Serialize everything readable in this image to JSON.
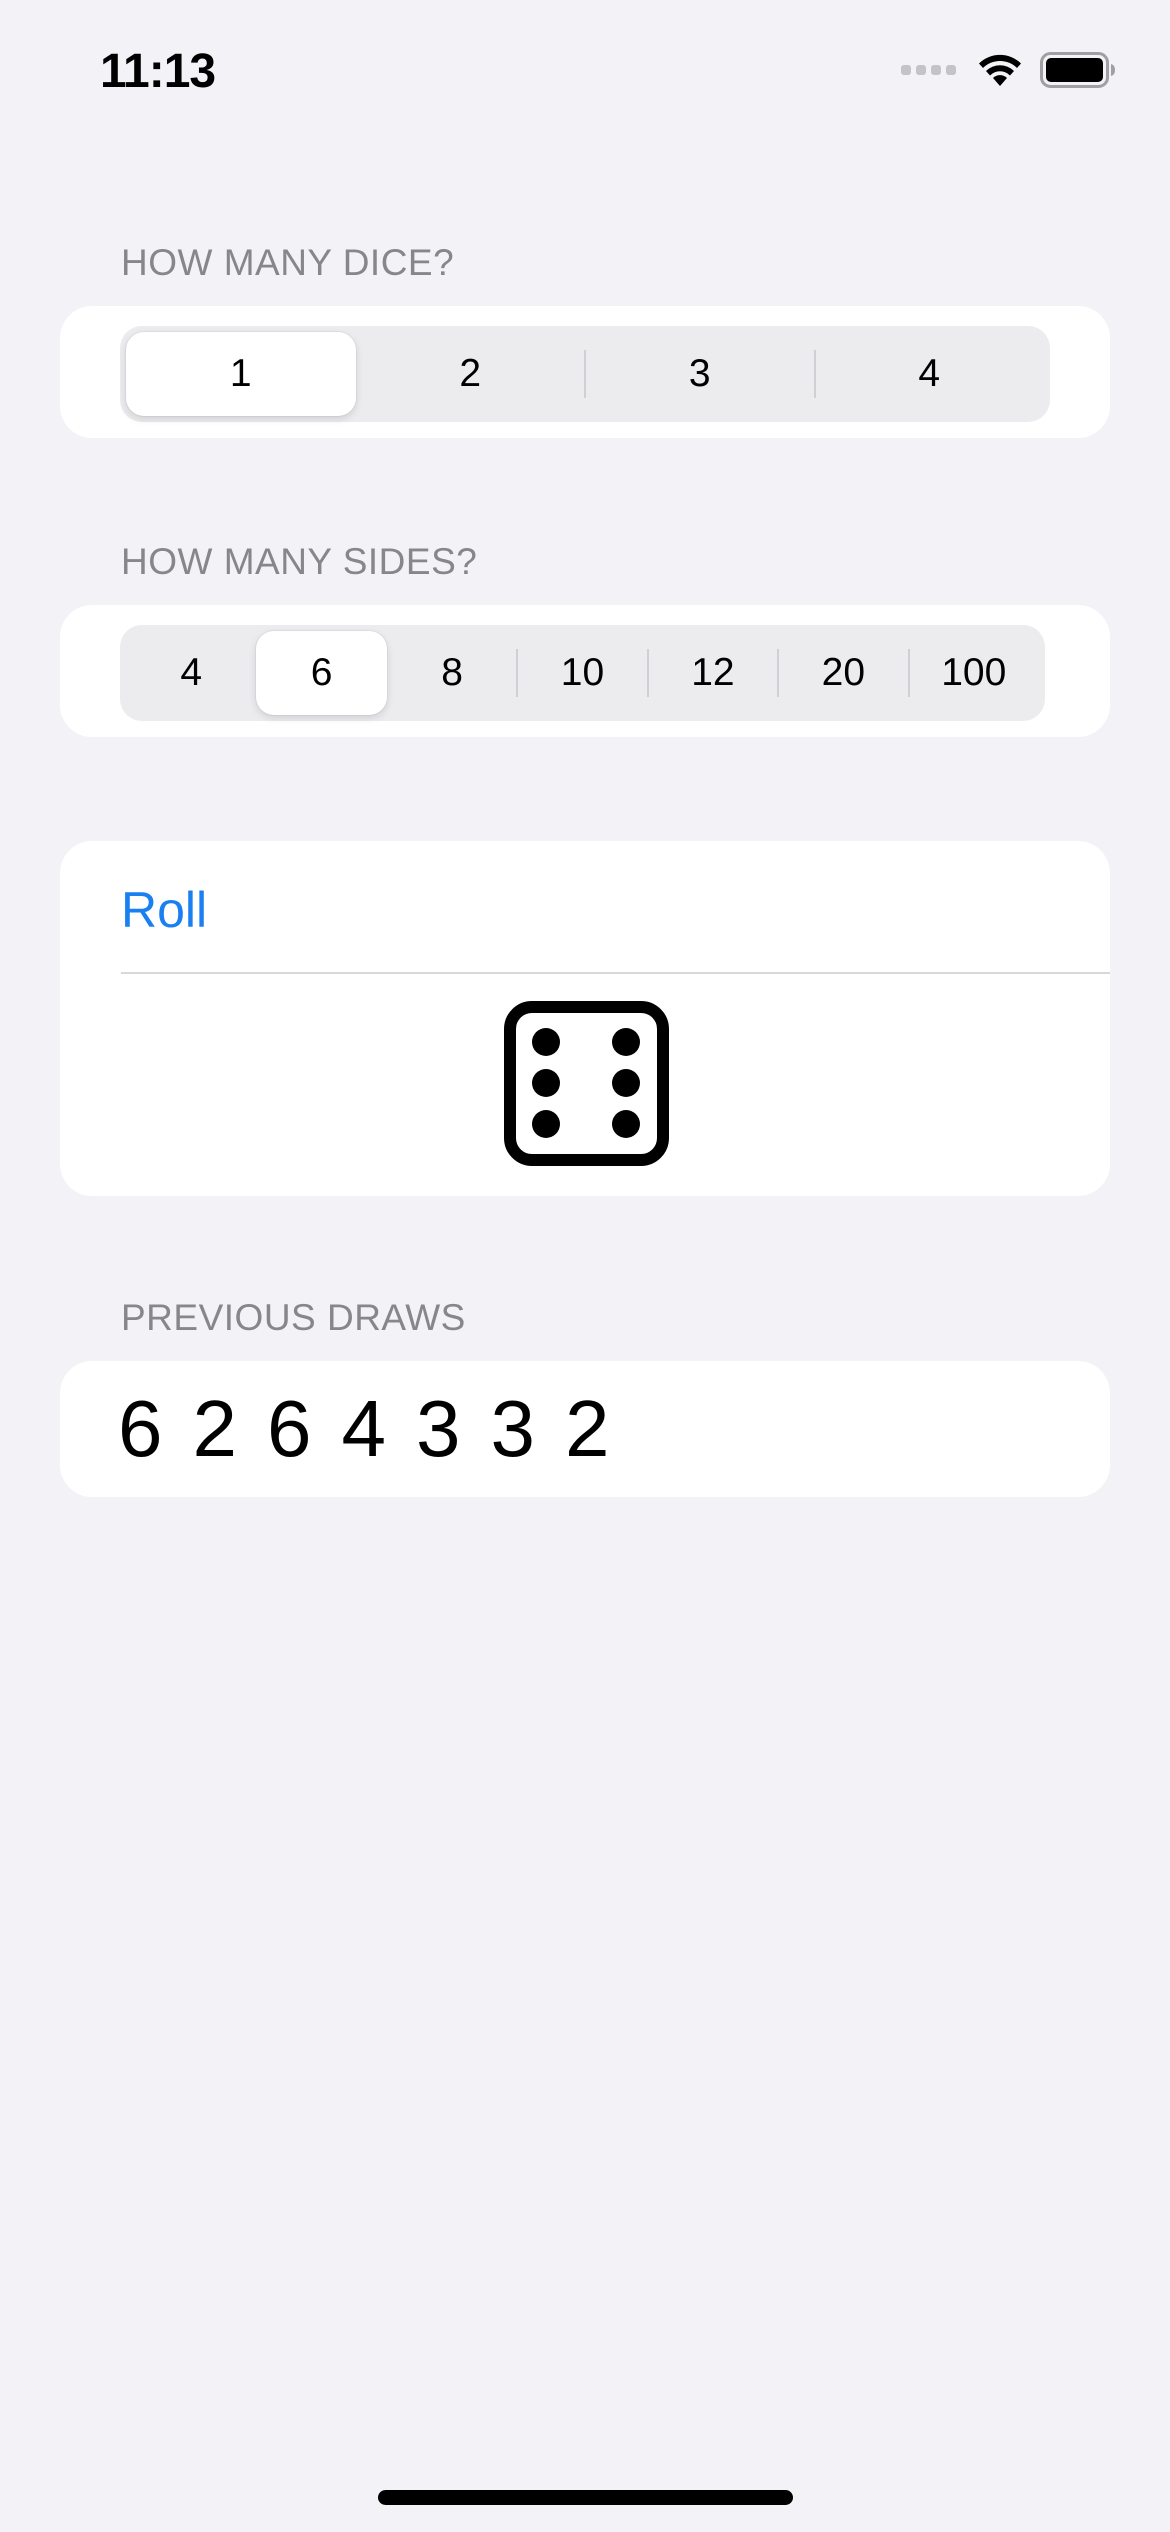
{
  "status_bar": {
    "time": "11:13"
  },
  "dice_section": {
    "header": "HOW MANY DICE?",
    "options": [
      "1",
      "2",
      "3",
      "4"
    ],
    "selected": "1"
  },
  "sides_section": {
    "header": "HOW MANY SIDES?",
    "options": [
      "4",
      "6",
      "8",
      "10",
      "12",
      "20",
      "100"
    ],
    "selected": "6"
  },
  "roll_section": {
    "button_label": "Roll",
    "die_face_value": 6,
    "die_icon": "die-face-6-icon"
  },
  "draws_section": {
    "header": "PREVIOUS DRAWS",
    "values": [
      "6",
      "2",
      "6",
      "4",
      "3",
      "3",
      "2"
    ]
  },
  "colors": {
    "background": "#f2f2f7",
    "card": "#ffffff",
    "accent": "#1a7ff0",
    "header_text": "#86868b"
  }
}
